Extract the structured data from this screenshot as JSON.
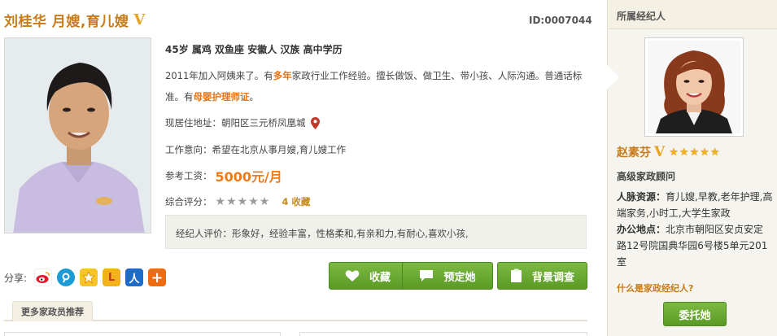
{
  "profile": {
    "title": "刘桂华 月嫂,育儿嫂",
    "verified_mark": "V",
    "id_text": "ID:0007044",
    "basic_info": "45岁 属鸡 双鱼座 安徽人 汉族 高中学历",
    "desc_part1": "2011年加入阿姨来了。有",
    "desc_hl1": "多年",
    "desc_part2": "家政行业工作经验。擅长做饭、做卫生、带小孩、人际沟通。普通话标准。有",
    "desc_hl2": "母婴护理师证",
    "desc_part3": "。",
    "address_label": "现居住地址：",
    "address_value": "朝阳区三元桥凤凰城",
    "intent_label": "工作意向：",
    "intent_value": "希望在北京从事月嫂,育儿嫂工作",
    "salary_label": "参考工资：",
    "salary_value": "5000元/月",
    "rating_label": "综合评分：",
    "rating_stars": 0,
    "rating_max": 5,
    "favorites": "4 收藏",
    "agent_comment": "经纪人评价：形象好，经验丰富，性格柔和,有亲和力,有耐心,喜欢小孩,"
  },
  "share": {
    "label": "分享:",
    "icons": [
      "weibo-icon",
      "tencent-weibo-icon",
      "qzone-icon",
      "douban-icon",
      "renren-icon",
      "more-plus-icon"
    ]
  },
  "actions": {
    "favorite": "收藏",
    "book": "预定她",
    "background_check": "背景调查"
  },
  "recommend_tab": "更多家政员推荐",
  "agent": {
    "header": "所属经纪人",
    "name": "赵素芬",
    "verified_mark": "V",
    "stars": 5,
    "title": "高级家政顾问",
    "resources_label": "人脉资源：",
    "resources_value": "育儿嫂,早教,老年护理,高端家务,小时工,大学生家政",
    "office_label": "办公地点：",
    "office_value": "北京市朝阳区安贞安定路12号院国典华园6号楼5单元201室",
    "what_is_agent": "什么是家政经纪人?",
    "entrust_button": "委托她"
  },
  "colors": {
    "brand_orange": "#c77b1a",
    "highlight_orange": "#e67316",
    "button_green": "#6aa830"
  }
}
